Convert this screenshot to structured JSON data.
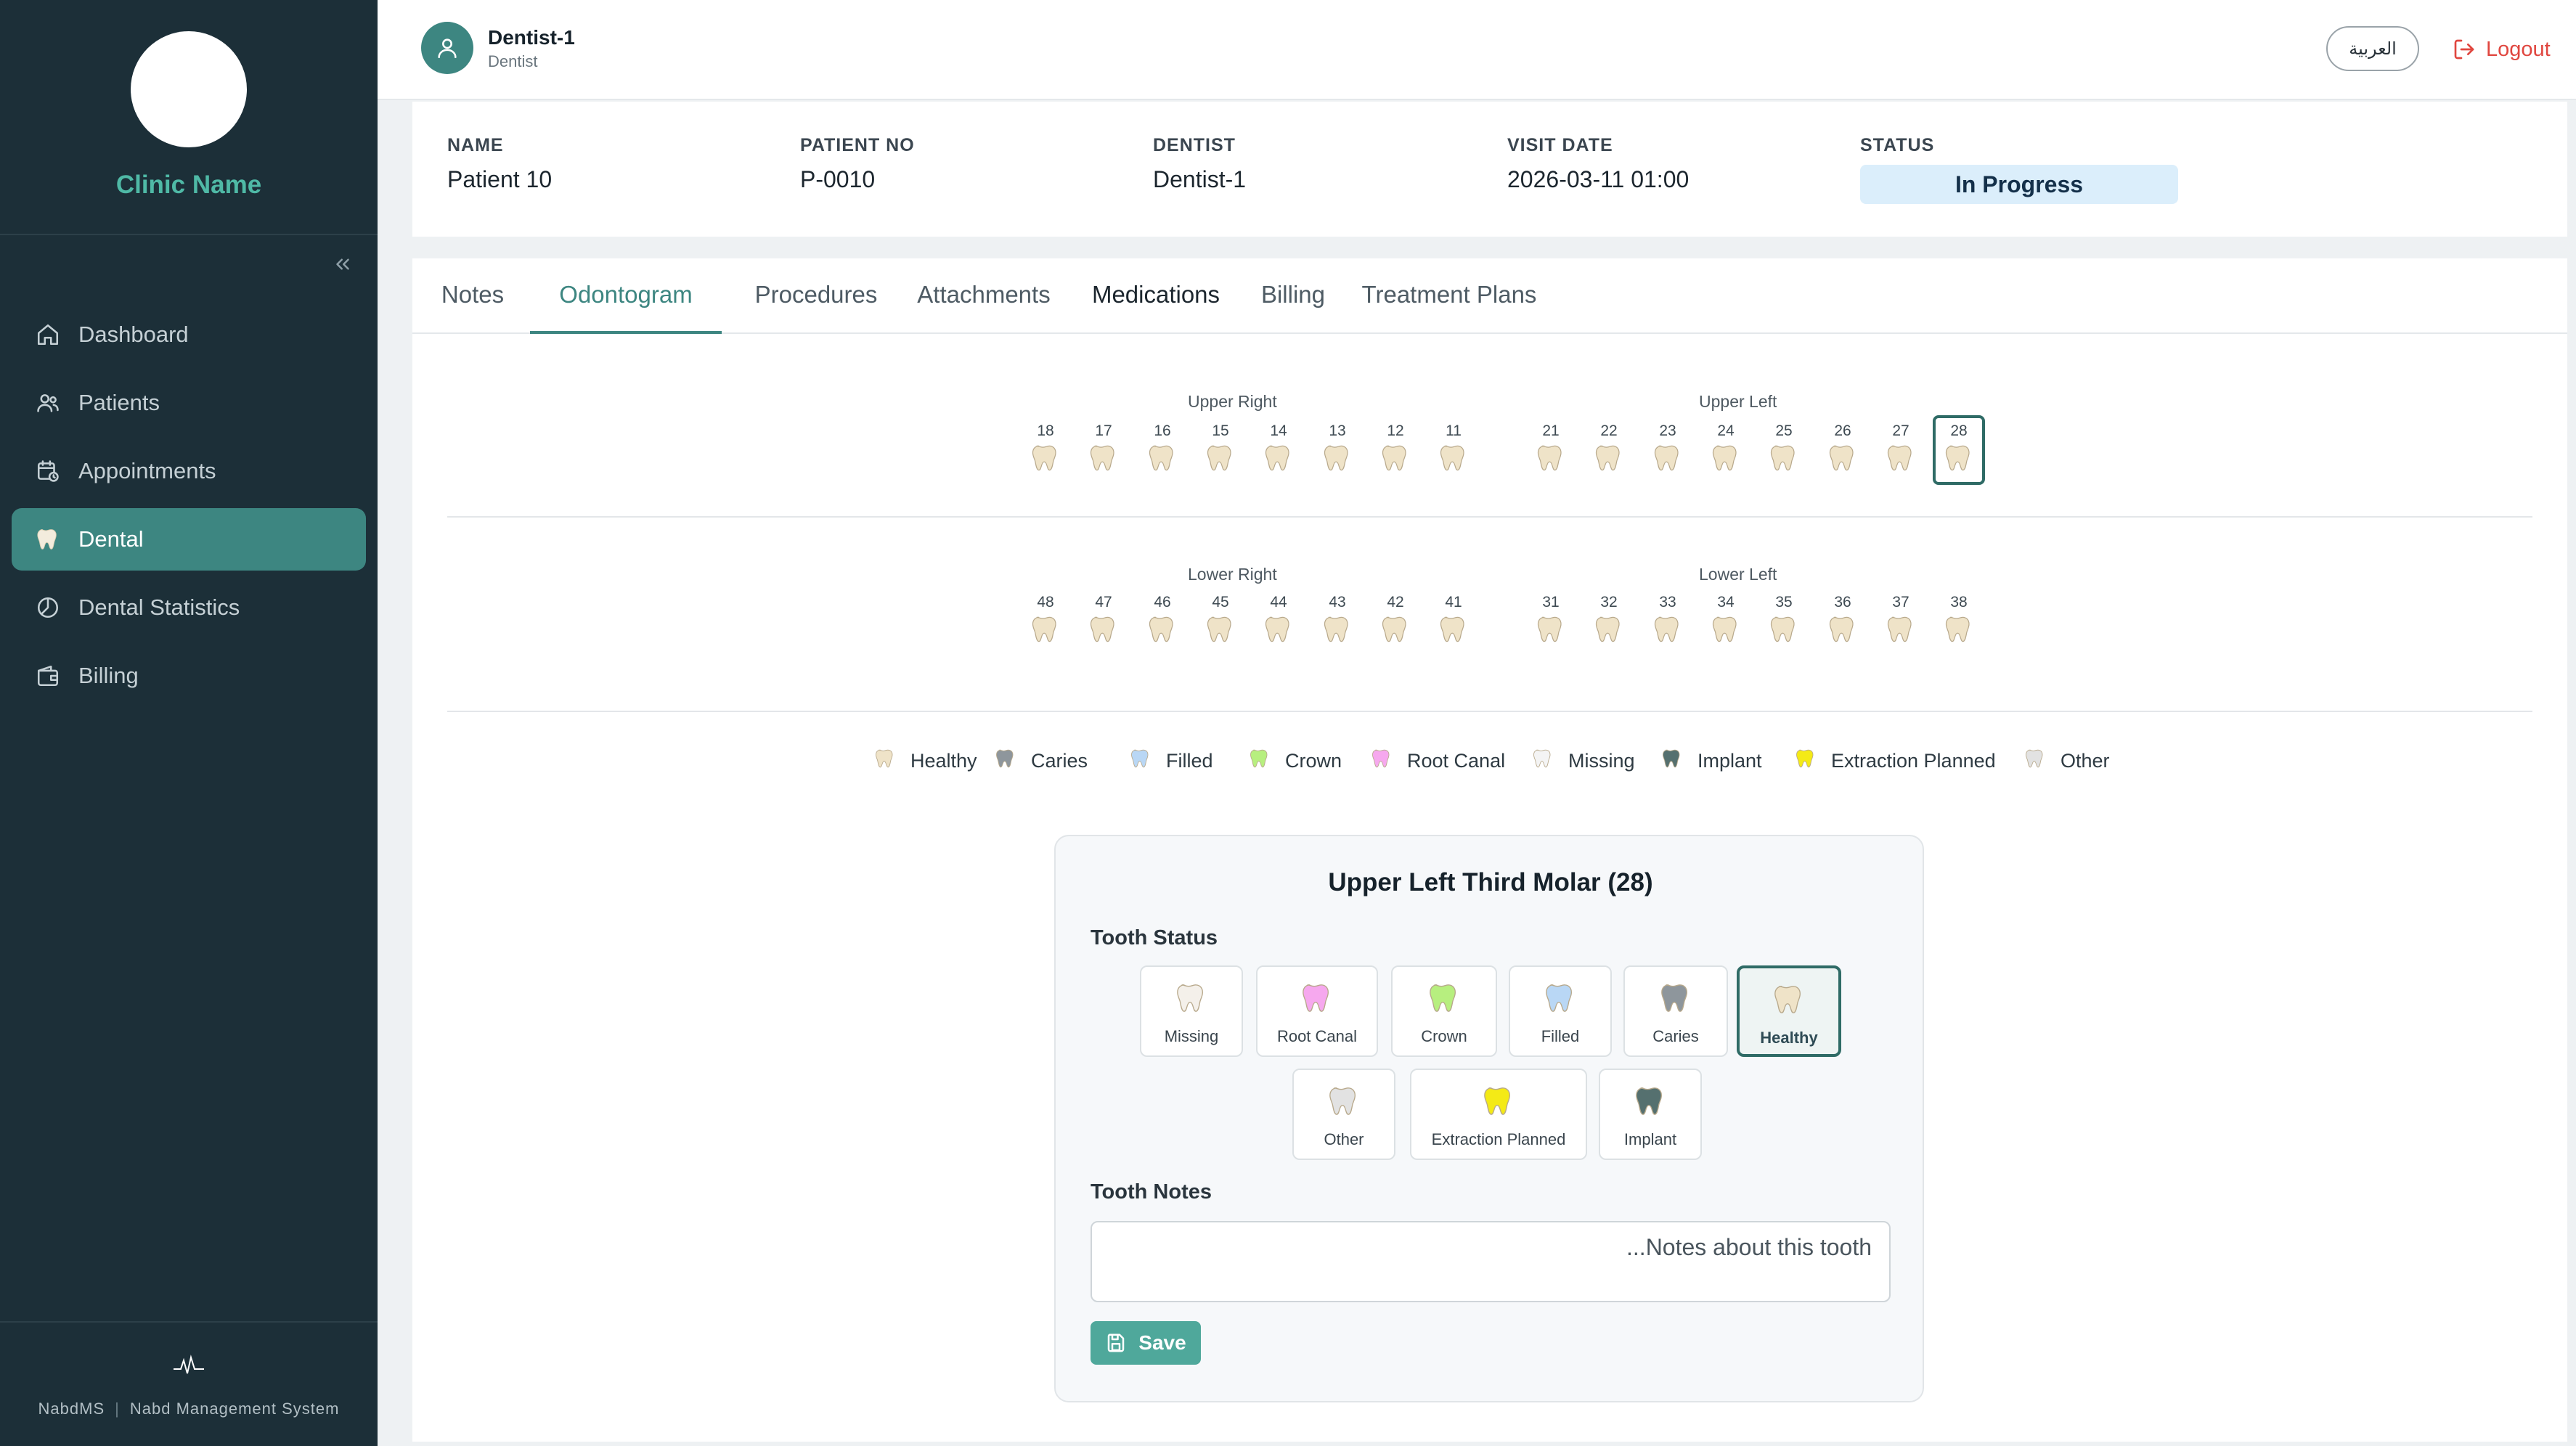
{
  "sidebar": {
    "clinic_name": "Clinic Name",
    "nav": [
      {
        "label": "Dashboard",
        "icon": "home-icon"
      },
      {
        "label": "Patients",
        "icon": "users-icon"
      },
      {
        "label": "Appointments",
        "icon": "calendar-clock-icon"
      },
      {
        "label": "Dental",
        "icon": "tooth-icon",
        "active": true
      },
      {
        "label": "Dental Statistics",
        "icon": "pie-chart-icon"
      },
      {
        "label": "Billing",
        "icon": "wallet-icon"
      }
    ],
    "footer": {
      "brand": "NabdMS",
      "tagline": "Nabd Management System"
    }
  },
  "topbar": {
    "user_name": "Dentist-1",
    "user_role": "Dentist",
    "language_button": "العربية",
    "logout_label": "Logout"
  },
  "patient": {
    "name_label": "NAME",
    "name": "Patient 10",
    "patient_no_label": "PATIENT NO",
    "patient_no": "P-0010",
    "dentist_label": "DENTIST",
    "dentist": "Dentist-1",
    "visit_date_label": "VISIT DATE",
    "visit_date": "2026-03-11 01:00",
    "status_label": "STATUS",
    "status": "In Progress"
  },
  "tabs": [
    {
      "label": "Notes"
    },
    {
      "label": "Odontogram",
      "active": true
    },
    {
      "label": "Procedures"
    },
    {
      "label": "Attachments"
    },
    {
      "label": "Medications"
    },
    {
      "label": "Billing"
    },
    {
      "label": "Treatment Plans"
    }
  ],
  "odontogram": {
    "upper_right_label": "Upper Right",
    "upper_left_label": "Upper Left",
    "lower_right_label": "Lower Right",
    "lower_left_label": "Lower Left",
    "upper_right": [
      "18",
      "17",
      "16",
      "15",
      "14",
      "13",
      "12",
      "11"
    ],
    "upper_left": [
      "21",
      "22",
      "23",
      "24",
      "25",
      "26",
      "27",
      "28"
    ],
    "lower_right": [
      "48",
      "47",
      "46",
      "45",
      "44",
      "43",
      "42",
      "41"
    ],
    "lower_left": [
      "31",
      "32",
      "33",
      "34",
      "35",
      "36",
      "37",
      "38"
    ],
    "selected_tooth": "28"
  },
  "legend": [
    {
      "label": "Healthy",
      "color": "#efe3c8"
    },
    {
      "label": "Caries",
      "color": "#8e969c"
    },
    {
      "label": "Filled",
      "color": "#b9d7f5"
    },
    {
      "label": "Crown",
      "color": "#b7ef7f"
    },
    {
      "label": "Root Canal",
      "color": "#f6a8ee"
    },
    {
      "label": "Missing",
      "color": "#f4f4f4"
    },
    {
      "label": "Implant",
      "color": "#55706f"
    },
    {
      "label": "Extraction Planned",
      "color": "#f4ea16"
    },
    {
      "label": "Other",
      "color": "#e2e2e2"
    }
  ],
  "editor": {
    "title": "Upper Left Third Molar (28)",
    "status_label": "Tooth Status",
    "options_row1": [
      {
        "label": "Missing",
        "color": "#f4f0ea"
      },
      {
        "label": "Root Canal",
        "color": "#f6a8ee"
      },
      {
        "label": "Crown",
        "color": "#b7ef7f"
      },
      {
        "label": "Filled",
        "color": "#b9d7f5"
      },
      {
        "label": "Caries",
        "color": "#8e969c"
      },
      {
        "label": "Healthy",
        "color": "#efe3c8",
        "selected": true
      }
    ],
    "options_row2": [
      {
        "label": "Other",
        "color": "#e2e2e2"
      },
      {
        "label": "Extraction Planned",
        "color": "#f4ea16"
      },
      {
        "label": "Implant",
        "color": "#55706f"
      }
    ],
    "notes_label": "Tooth Notes",
    "notes_placeholder": "Notes about this tooth...",
    "save_label": "Save"
  }
}
